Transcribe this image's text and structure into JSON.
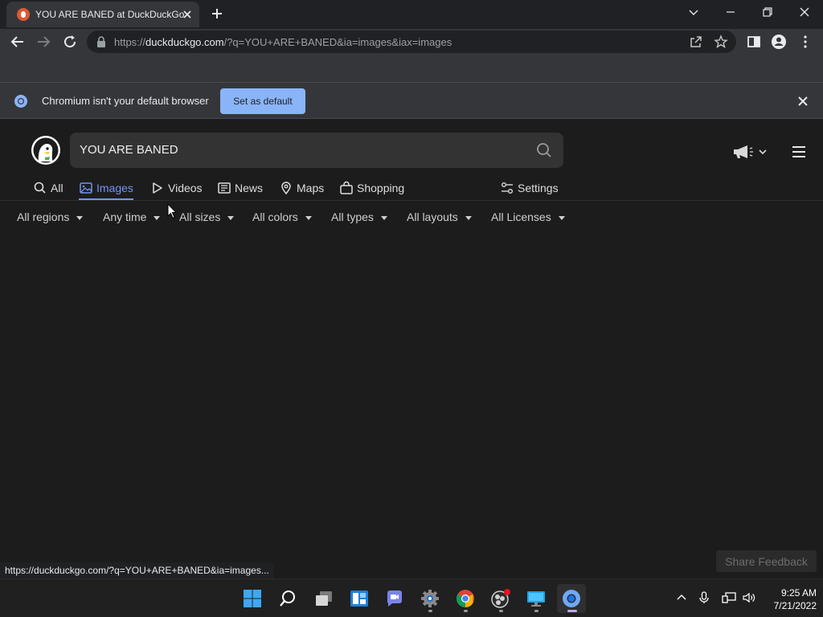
{
  "browser": {
    "tab": {
      "title": "YOU ARE BANED at DuckDuckGo",
      "favicon": "duckduckgo-icon"
    },
    "url": {
      "scheme": "https://",
      "host": "duckduckgo.com",
      "path": "/?q=YOU+ARE+BANED&ia=images&iax=images"
    },
    "infobar": {
      "message": "Chromium isn't your default browser",
      "button_label": "Set as default"
    },
    "status_url": "https://duckduckgo.com/?q=YOU+ARE+BANED&ia=images..."
  },
  "ddg": {
    "search_query": "YOU ARE BANED",
    "accent_color": "#7295f6",
    "tabs": [
      {
        "label": "All",
        "icon": "search-icon"
      },
      {
        "label": "Images",
        "icon": "image-icon",
        "active": true
      },
      {
        "label": "Videos",
        "icon": "play-icon"
      },
      {
        "label": "News",
        "icon": "newspaper-icon"
      },
      {
        "label": "Maps",
        "icon": "map-pin-icon"
      },
      {
        "label": "Shopping",
        "icon": "shopping-bag-icon"
      }
    ],
    "settings_label": "Settings",
    "filters": [
      "All regions",
      "Any time",
      "All sizes",
      "All colors",
      "All types",
      "All layouts",
      "All Licenses"
    ],
    "share_feedback": "Share Feedback"
  },
  "taskbar": {
    "apps": [
      "windows-start-icon",
      "search-icon",
      "task-view-icon",
      "widgets-icon",
      "teams-chat-icon",
      "settings-gear-icon",
      "chrome-icon",
      "obs-icon",
      "remote-desktop-icon",
      "chromium-icon"
    ],
    "time": "9:25 AM",
    "date": "7/21/2022"
  }
}
